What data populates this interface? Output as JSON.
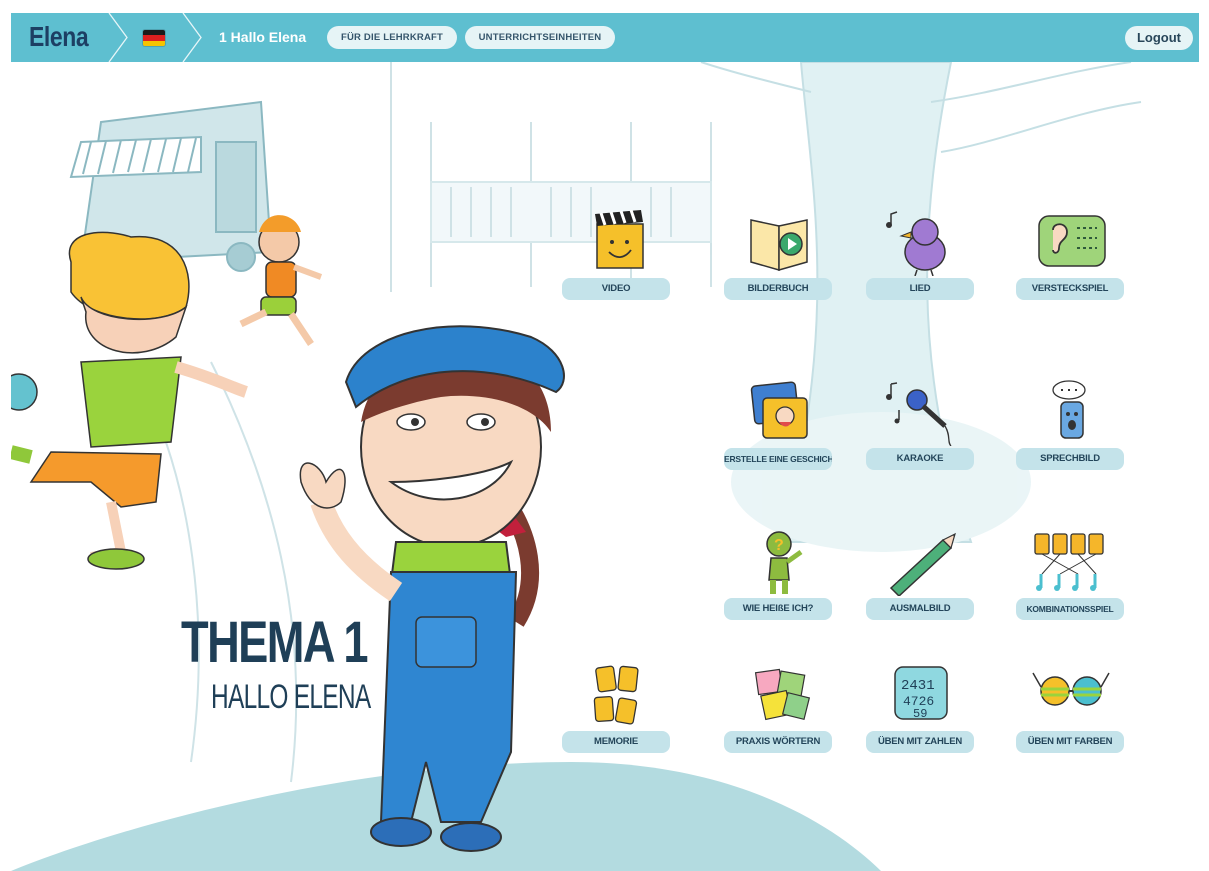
{
  "app": {
    "logo": "Elena"
  },
  "header": {
    "language_flag": "german-flag-icon",
    "title": "1 Hallo Elena",
    "buttons": [
      "FÜR DIE LEHRKRAFT",
      "UNTERRICHTSEINHEITEN"
    ],
    "logout": "Logout"
  },
  "theme": {
    "number": "THEMA 1",
    "name": "HALLO ELENA"
  },
  "activities": [
    {
      "label": "VIDEO",
      "icon": "clapperboard-icon"
    },
    {
      "label": "BILDERBUCH",
      "icon": "picture-book-icon"
    },
    {
      "label": "LIED",
      "icon": "singing-bird-icon"
    },
    {
      "label": "VERSTECKSPIEL",
      "icon": "hide-and-seek-ear-icon"
    },
    {
      "label": "ERSTELLE EINE GESCHICHTE",
      "icon": "story-cards-icon"
    },
    {
      "label": "KARAOKE",
      "icon": "microphone-icon"
    },
    {
      "label": "SPRECHBILD",
      "icon": "talking-phone-icon"
    },
    {
      "label": "WIE HEIßE ICH?",
      "icon": "question-figure-icon"
    },
    {
      "label": "AUSMALBILD",
      "icon": "pencil-icon"
    },
    {
      "label": "KOMBINATIONSSPIEL",
      "icon": "matching-cards-icon"
    },
    {
      "label": "MEMORIE",
      "icon": "memory-cards-icon"
    },
    {
      "label": "PRAXIS WÖRTERN",
      "icon": "sticky-notes-icon"
    },
    {
      "label": "ÜBEN MIT ZAHLEN",
      "icon": "numbers-icon"
    },
    {
      "label": "ÜBEN MIT FARBEN",
      "icon": "colored-glasses-icon"
    }
  ],
  "colors": {
    "header": "#5ebfd0",
    "label_bg": "#c4e3ea",
    "text_dark": "#1f3f57",
    "hill": "#b3dbe0"
  }
}
